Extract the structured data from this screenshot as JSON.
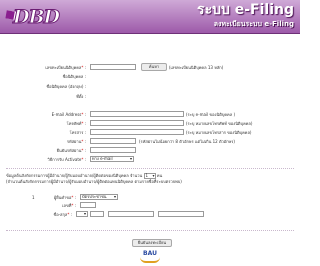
{
  "header": {
    "logo": "DBD",
    "title": "ระบบ e-Filing",
    "subtitle": "ลงทะเบียนระบบ e-Filing"
  },
  "form": {
    "reg_no_label": "เลขทะเบียนนิติบุคคล",
    "search_button": "ค้นหา",
    "reg_no_note": "(เลขทะเบียนนิติบุคคล 13 หลัก)",
    "name_th_label": "ชื่อนิติบุคคล :",
    "name_en_label": "ชื่อนิติบุคคล (อังกฤษ) :",
    "address_label": "ที่ตั้ง :",
    "email_label": "E-mail Address",
    "email_note": "(ระบุ e-mail ของนิติบุคคล )",
    "mobile_label": "โทรศัพท์",
    "mobile_note": "(ระบุ หมายเลขโทรศัพท์ ของนิติบุคคล)",
    "fax_label": "โทรสาร :",
    "fax_note": "(ระบุ หมายเลขโทรสาร ของนิติบุคคล)",
    "password_label": "รหัสผ่าน",
    "password_note": "(รหัสผ่านไม่น้อยกว่า 8 ตัวอักษร แต่ไม่เกิน 12 ตัวอักษร)",
    "confirm_label": "ยืนยันรหัสผ่าน",
    "activate_label": "วิธีการรับ Activate",
    "activate_value": "ทาง e-mail",
    "required_mark": "*",
    "signer_intro_1": "ข้อมูลต้นสังกัดกรรมการผู้มีอำนาจ/ผู้รับมอบอำนาจ/ผู้ติดต่อของนิติบุคคล จำนวน",
    "signer_count": "1",
    "signer_intro_unit": "คน",
    "signer_intro_2": "(จำนวนต้นสังกัดกรรมการผู้มีอำนาจ/ผู้รับมอบอำนาจ/ผู้ติดต่อแทนนิติบุคคล ตามรายชื่อที่ระบบตรวจพบ)",
    "row_number": "1",
    "id_type_label": "ผู้ยื่นคำขอ",
    "id_type_value": "บัตรประชาชน",
    "id_no_label": "เลขที่",
    "name_label": "ชื่อ-สกุล",
    "title_value": "",
    "submit_button": "ยืนยันลงทะเบียน"
  },
  "footer": {
    "logo": "BAU"
  },
  "colors": {
    "header_top": "#cfa9d7",
    "header_bottom": "#9d5aa9",
    "required": "#d00000",
    "footer_logo": "#2a4aa0"
  }
}
